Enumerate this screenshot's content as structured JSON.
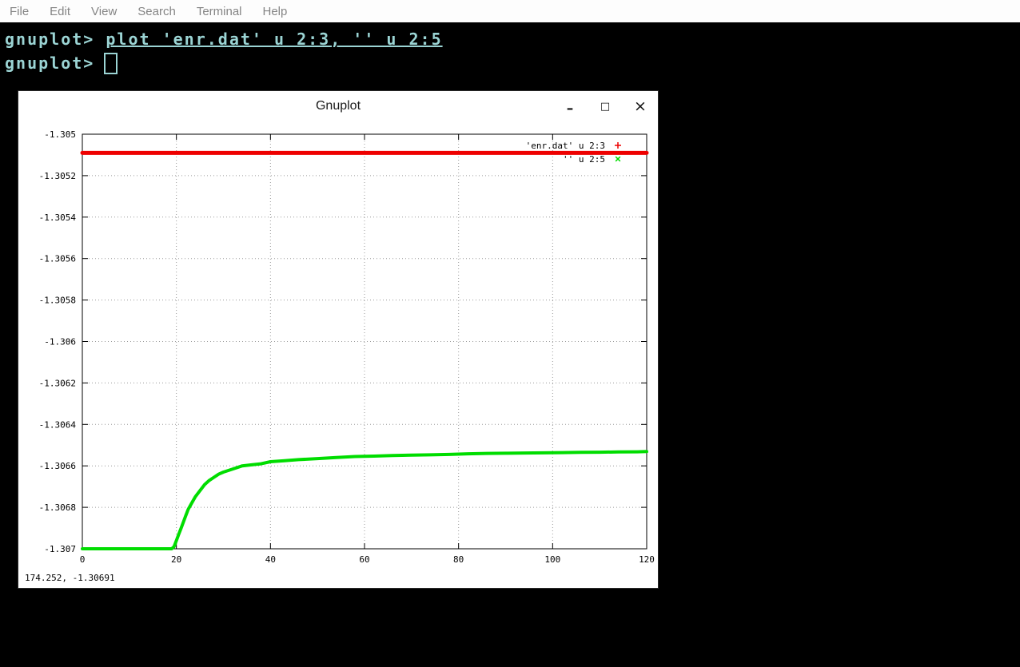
{
  "menu_bar": {
    "items": [
      "File",
      "Edit",
      "View",
      "Search",
      "Terminal",
      "Help"
    ]
  },
  "terminal": {
    "prompt": "gnuplot>",
    "command": "plot 'enr.dat' u 2:3, '' u 2:5",
    "text_color": "#9bd4d4",
    "background": "#000000"
  },
  "gnuplot_window": {
    "title": "Gnuplot",
    "controls": [
      {
        "name": "minimize-icon",
        "glyph": "–"
      },
      {
        "name": "maximize-icon",
        "glyph": "□"
      },
      {
        "name": "close-icon",
        "glyph": "×"
      }
    ],
    "coord_readout": "174.252, -1.30691"
  },
  "chart_data": {
    "type": "line",
    "title": "",
    "xlabel": "",
    "ylabel": "",
    "xlim": [
      0,
      120
    ],
    "ylim": [
      -1.307,
      -1.305
    ],
    "grid": true,
    "legend_position": "top-right",
    "xticks": [
      0,
      20,
      40,
      60,
      80,
      100,
      120
    ],
    "xtick_labels": [
      "0",
      "20",
      "40",
      "60",
      "80",
      "100",
      "120"
    ],
    "yticks": [
      -1.305,
      -1.3052,
      -1.3054,
      -1.3056,
      -1.3058,
      -1.306,
      -1.3062,
      -1.3064,
      -1.3066,
      -1.3068,
      -1.307
    ],
    "ytick_labels": [
      "-1.305",
      "-1.3052",
      "-1.3054",
      "-1.3056",
      "-1.3058",
      "-1.306",
      "-1.3062",
      "-1.3064",
      "-1.3066",
      "-1.3068",
      "-1.307"
    ],
    "series": [
      {
        "name": "'enr.dat' u 2:3",
        "color": "#ee0000",
        "marker": "+",
        "width": 5,
        "points": [
          [
            0,
            -1.30509
          ],
          [
            120,
            -1.30509
          ]
        ]
      },
      {
        "name": "'' u 2:5",
        "color": "#00dd00",
        "marker": "x",
        "width": 4,
        "points": [
          [
            0,
            -1.307
          ],
          [
            4,
            -1.307
          ],
          [
            8,
            -1.307
          ],
          [
            12,
            -1.307
          ],
          [
            16,
            -1.307
          ],
          [
            19,
            -1.307
          ],
          [
            19.5,
            -1.30699
          ],
          [
            20,
            -1.30696
          ],
          [
            20.5,
            -1.30693
          ],
          [
            21,
            -1.3069
          ],
          [
            21.5,
            -1.30687
          ],
          [
            22,
            -1.30684
          ],
          [
            22.5,
            -1.30681
          ],
          [
            23,
            -1.30679
          ],
          [
            24,
            -1.30675
          ],
          [
            25,
            -1.30672
          ],
          [
            26,
            -1.30669
          ],
          [
            27,
            -1.30667
          ],
          [
            28,
            -1.306655
          ],
          [
            29,
            -1.30664
          ],
          [
            30,
            -1.30663
          ],
          [
            32,
            -1.306615
          ],
          [
            34,
            -1.3066
          ],
          [
            36,
            -1.306595
          ],
          [
            38,
            -1.30659
          ],
          [
            40,
            -1.30658
          ],
          [
            43,
            -1.306575
          ],
          [
            46,
            -1.30657
          ],
          [
            50,
            -1.306565
          ],
          [
            54,
            -1.30656
          ],
          [
            58,
            -1.306555
          ],
          [
            62,
            -1.306553
          ],
          [
            66,
            -1.30655
          ],
          [
            70,
            -1.306548
          ],
          [
            74,
            -1.306547
          ],
          [
            78,
            -1.306545
          ],
          [
            82,
            -1.306542
          ],
          [
            86,
            -1.30654
          ],
          [
            90,
            -1.306539
          ],
          [
            94,
            -1.306538
          ],
          [
            98,
            -1.306537
          ],
          [
            102,
            -1.306536
          ],
          [
            106,
            -1.306535
          ],
          [
            110,
            -1.306534
          ],
          [
            114,
            -1.306533
          ],
          [
            118,
            -1.306532
          ],
          [
            120,
            -1.306531
          ]
        ]
      }
    ]
  }
}
